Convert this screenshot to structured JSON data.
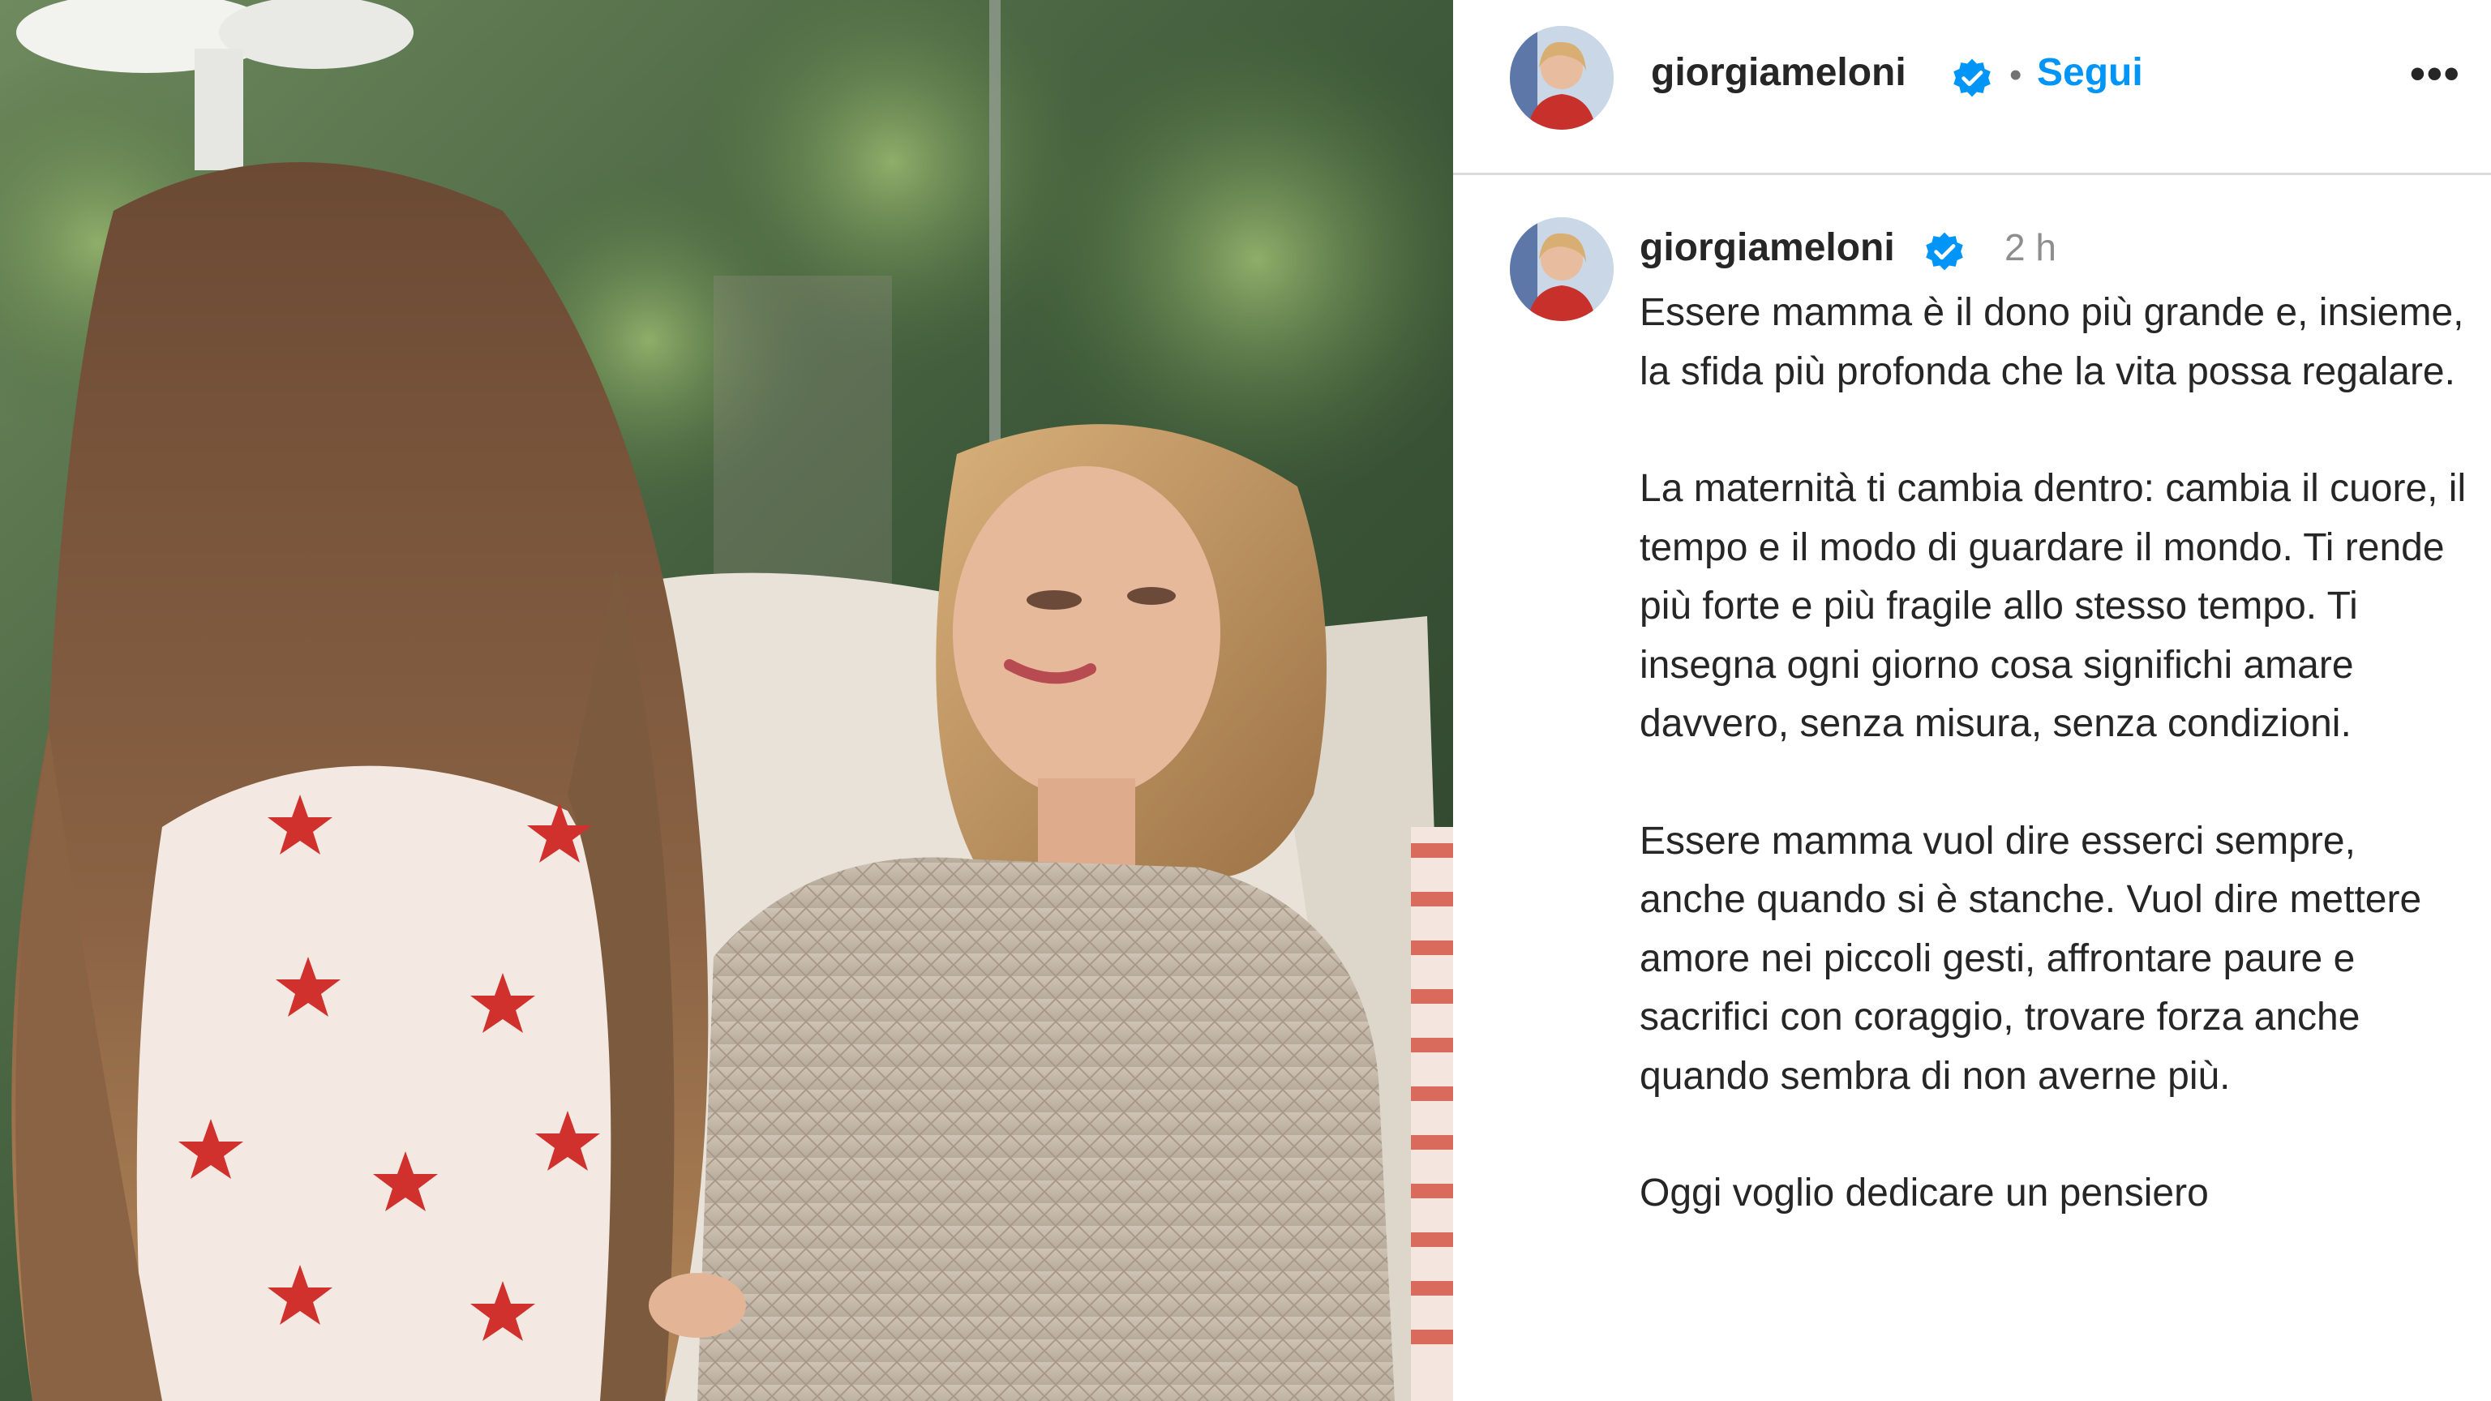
{
  "header": {
    "username": "giorgiameloni",
    "separator": "•",
    "follow_label": "Segui",
    "more_icon": "more-horizontal-icon",
    "more_label": "•••"
  },
  "post": {
    "username": "giorgiameloni",
    "timestamp": "2 h",
    "caption_paragraphs": [
      "Essere mamma è il dono più grande e, insieme, la sfida più profonda che la vita possa regalare.",
      "La maternità ti cambia dentro: cambia il cuore, il tempo e il modo di guardare il mondo. Ti rende più forte e più fragile allo stesso tempo. Ti insegna ogni giorno cosa significhi amare davvero, senza misura, senza condizioni.",
      "Essere mamma vuol dire esserci sempre, anche quando si è stanche. Vuol dire mettere amore nei piccoli gesti, affrontare paure e sacrifici con coraggio, trovare forza anche quando sembra di non averne più.",
      "Oggi voglio dedicare un pensiero"
    ]
  },
  "colors": {
    "link_blue": "#0095f6",
    "verified_blue": "#0095f6",
    "divider": "#dbdbdb",
    "muted": "#8e8e8e"
  }
}
